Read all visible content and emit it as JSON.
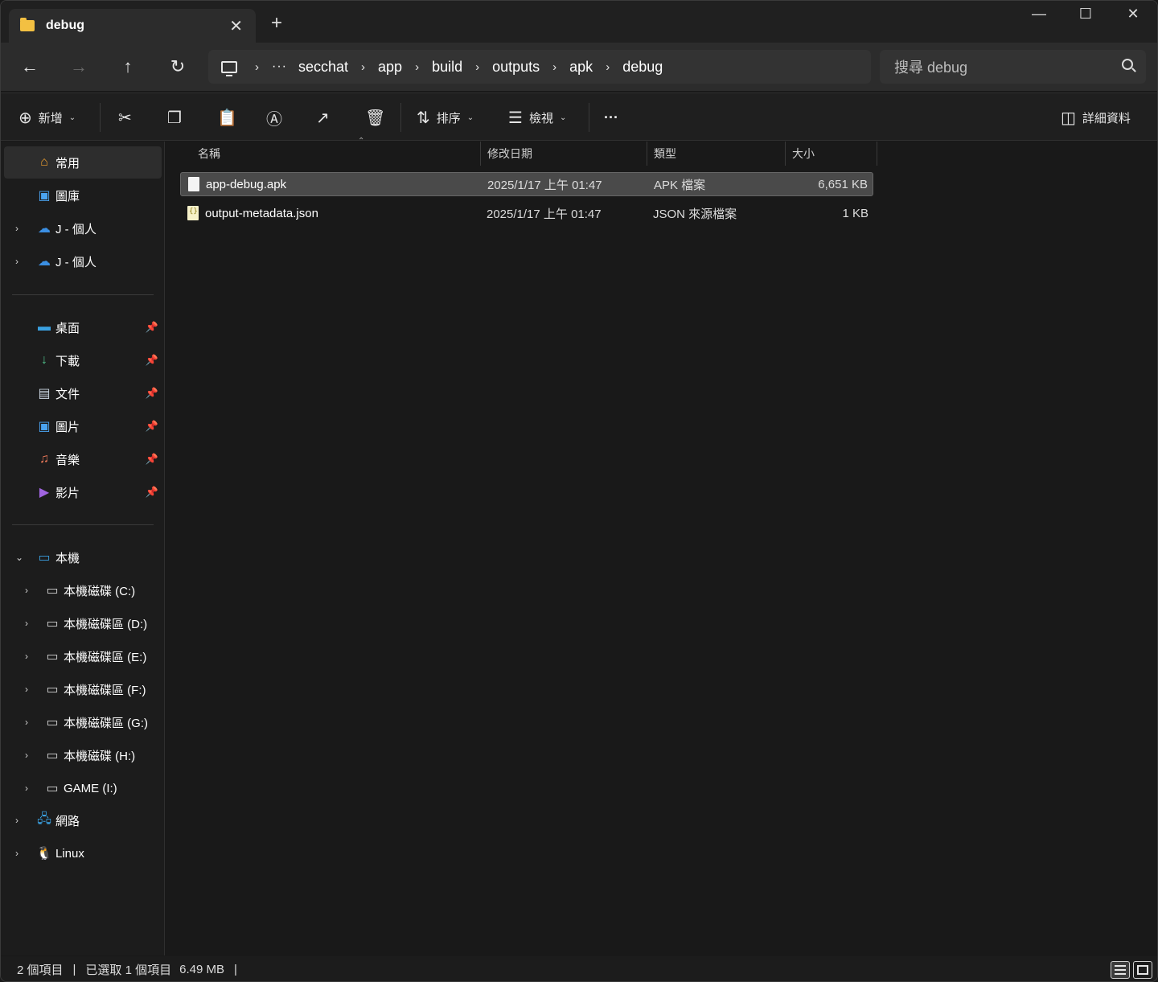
{
  "tab": {
    "title": "debug",
    "close": "✕",
    "new": "+"
  },
  "window_controls": {
    "minimize": "—",
    "maximize": "☐",
    "close": "✕"
  },
  "nav": {
    "back": "←",
    "forward": "→",
    "up": "↑",
    "refresh": "↻"
  },
  "breadcrumb": {
    "more": "···",
    "sep": "›",
    "items": [
      "secchat",
      "app",
      "build",
      "outputs",
      "apk",
      "debug"
    ]
  },
  "search": {
    "placeholder": "搜尋 debug"
  },
  "commands": {
    "new": "新增",
    "sort": "排序",
    "view": "檢視",
    "more": "···",
    "details": "詳細資料"
  },
  "sidebar": {
    "quick": [
      {
        "label": "常用",
        "icon": "home-icon"
      },
      {
        "label": "圖庫",
        "icon": "gallery-icon"
      },
      {
        "label": "J - 個人",
        "icon": "onedrive-icon"
      },
      {
        "label": "J - 個人",
        "icon": "onedrive-icon"
      }
    ],
    "pinned": [
      {
        "label": "桌面",
        "icon": "desktop-icon"
      },
      {
        "label": "下載",
        "icon": "download-icon"
      },
      {
        "label": "文件",
        "icon": "documents-icon"
      },
      {
        "label": "圖片",
        "icon": "pictures-icon"
      },
      {
        "label": "音樂",
        "icon": "music-icon"
      },
      {
        "label": "影片",
        "icon": "videos-icon"
      }
    ],
    "this_pc": {
      "label": "本機"
    },
    "drives": [
      {
        "label": "本機磁碟 (C:)"
      },
      {
        "label": "本機磁碟區 (D:)"
      },
      {
        "label": "本機磁碟區 (E:)"
      },
      {
        "label": "本機磁碟區 (F:)"
      },
      {
        "label": "本機磁碟區 (G:)"
      },
      {
        "label": "本機磁碟 (H:)"
      },
      {
        "label": "GAME (I:)"
      }
    ],
    "network": {
      "label": "網路"
    },
    "linux": {
      "label": "Linux"
    }
  },
  "columns": {
    "name": "名稱",
    "date": "修改日期",
    "type": "類型",
    "size": "大小"
  },
  "files": [
    {
      "name": "app-debug.apk",
      "date": "2025/1/17 上午 01:47",
      "type": "APK 檔案",
      "size": "6,651 KB",
      "icon": "file-icon"
    },
    {
      "name": "output-metadata.json",
      "date": "2025/1/17 上午 01:47",
      "type": "JSON 來源檔案",
      "size": "1 KB",
      "icon": "json-file-icon"
    }
  ],
  "status": {
    "count": "2 個項目",
    "selected": "已選取 1 個項目",
    "size": "6.49 MB",
    "sep": "|"
  },
  "colors": {
    "accent": "#f3c042",
    "background": "#191919",
    "selected_row": "#4a4a4a"
  }
}
